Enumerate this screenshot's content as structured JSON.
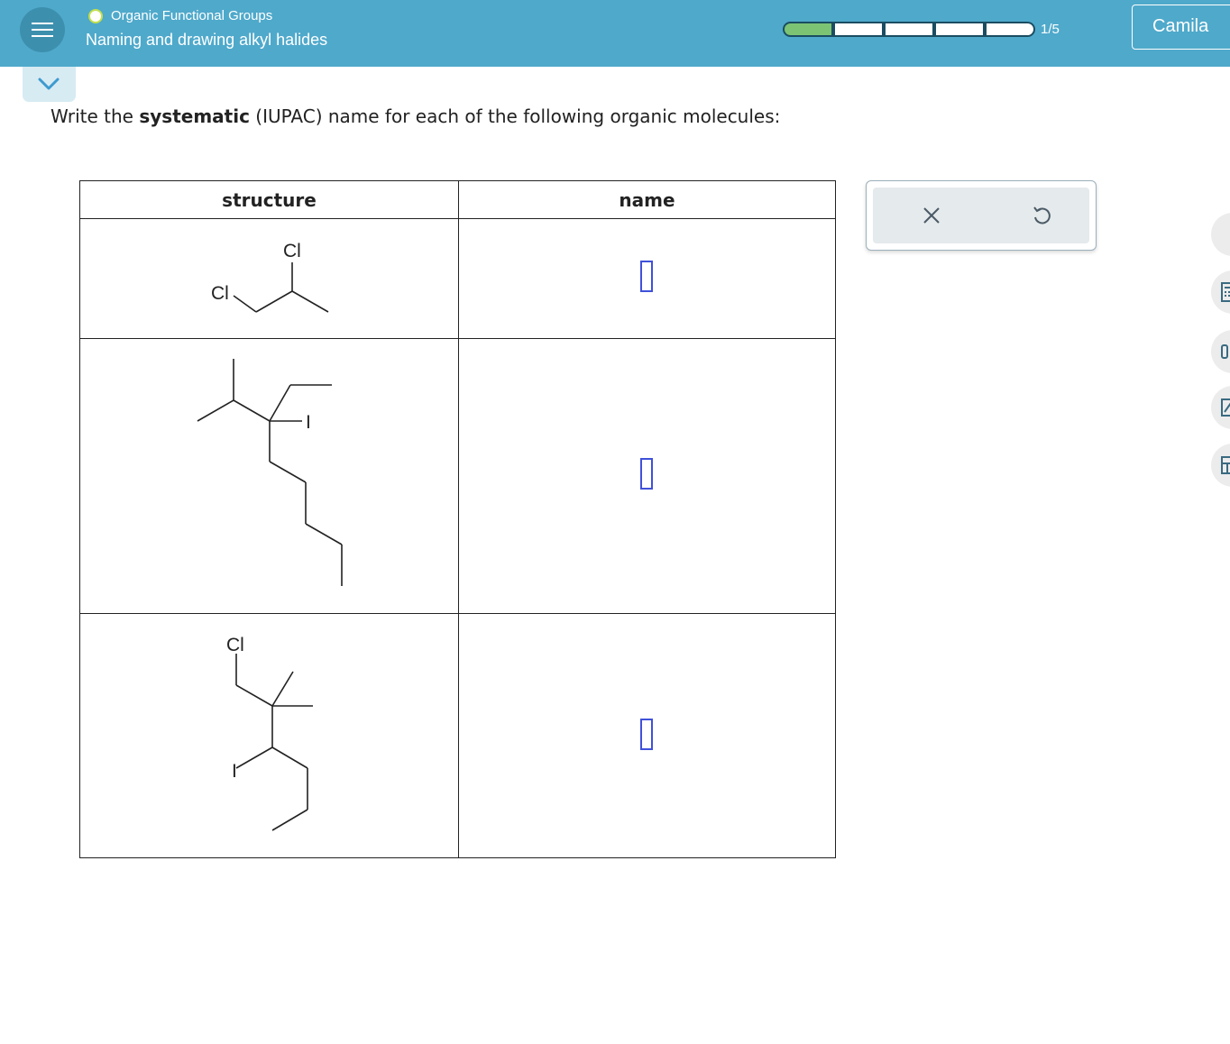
{
  "header": {
    "topic": "Organic Functional Groups",
    "subtopic": "Naming and drawing alkyl halides",
    "progress_label": "1/5",
    "progress": {
      "filled": 1,
      "total": 5
    },
    "user_name": "Camila"
  },
  "question": {
    "prompt_before": "Write the ",
    "prompt_bold": "systematic",
    "prompt_after": " (IUPAC) name for each of the following organic molecules:"
  },
  "table": {
    "header_structure": "structure",
    "header_name": "name",
    "rows": [
      {
        "labels": [
          "Cl",
          "Cl"
        ],
        "name_value": ""
      },
      {
        "labels": [
          "I"
        ],
        "name_value": ""
      },
      {
        "labels": [
          "Cl",
          "I"
        ],
        "name_value": ""
      }
    ]
  },
  "tools": {
    "clear_icon": "x-icon",
    "undo_icon": "undo-icon"
  },
  "colors": {
    "header_bg": "#4fa9cb",
    "progress_fill": "#7cc474",
    "answer_box_border": "#3f51d9",
    "status_dot": "#c4e04a"
  }
}
